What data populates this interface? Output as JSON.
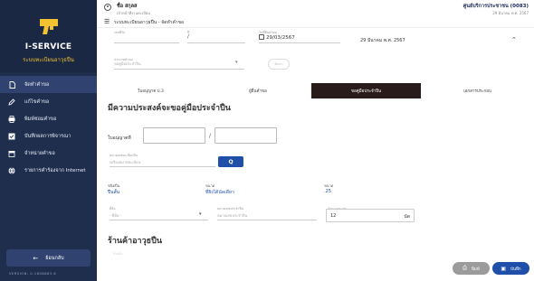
{
  "sidebar": {
    "title": "I-SERVICE",
    "subtitle": "ระบบทะเบียนอาวุธปืน",
    "items": [
      {
        "label": "จัดทำคำขอ",
        "icon": "document-icon"
      },
      {
        "label": "แก้ไขคำขอ",
        "icon": "edit-icon"
      },
      {
        "label": "พิมพ์ซ่อมคำขอ",
        "icon": "printer-icon"
      },
      {
        "label": "บันทึกผลการพิจารณา",
        "icon": "checklist-icon"
      },
      {
        "label": "จำหน่ายคำขอ",
        "icon": "archive-icon"
      },
      {
        "label": "รายการคำร้องจาก Internet",
        "icon": "globe-icon"
      }
    ],
    "back_label": "ย้อนกลับ",
    "version": "VERSION: 0.1808883.6"
  },
  "header": {
    "user_name": "ชื่อ สกุลส",
    "user_dept": "เจ้าหน้าที่งานทะเบียน",
    "breadcrumb": "ระบบทะเบียนอาวุธปืน - จัดทำคำขอ",
    "service_center": "ศูนย์บริการประชาชน (0083)",
    "date": "29 มีนาคม พ.ศ. 2567"
  },
  "form_top": {
    "field1_label": "เลขที่รับ",
    "field1_value": "",
    "field2_label": "ปี",
    "field2_value": "/",
    "date_label": "วันที่ยื่นคำขอ",
    "date_value": "29/03/2567",
    "date_text": "29 มีนาคม พ.ศ. 2567",
    "select_label": "ประเภทคำขอ",
    "select_placeholder": "ขอคู่มือประจำปืน",
    "pill_label": "ค้นหา"
  },
  "tabs": [
    {
      "label": "ใบอนุญาต ป.3"
    },
    {
      "label": "ผู้ยื่นคำขอ"
    },
    {
      "label": "ขอคู่มือประจำปืน"
    },
    {
      "label": "เอกสารประกอบ"
    }
  ],
  "section": {
    "title": "มีความประสงค์จะขอคู่มือประจำปืน",
    "license_label": "ใบอนุญาตที่",
    "slash": "/",
    "search_label": "หมายเลขทะเบียนปืน",
    "search_placeholder": "เครื่องหมายทะเบียน",
    "search_button": "Q",
    "info": [
      {
        "key": "ชนิดปืน",
        "value": "ปืนสั้น"
      },
      {
        "key": "ขนาด",
        "value": "ที่ยิงได้นัดเดียว"
      },
      {
        "key": "ขนาด",
        "value": ".25"
      }
    ],
    "brand_label": "ยี่ห้อ",
    "brand_value": "--ยี่ห้อ--",
    "serial_label": "หมายเลขประจำปืน",
    "serial_placeholder": "หมายเลขประจำปืน",
    "qty_label": "จำนวนกระสุน",
    "qty_value": "12",
    "qty_unit": "นัด"
  },
  "section2": {
    "title": "ร้านค้าอาวุธปืน",
    "hint": "ร้านค้า"
  },
  "buttons": {
    "print_label": "พิมพ์",
    "save_label": "บันทึก"
  }
}
